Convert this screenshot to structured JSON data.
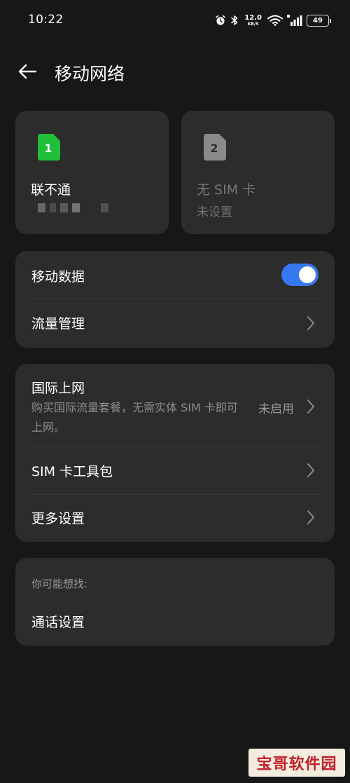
{
  "status_bar": {
    "time": "10:22",
    "net_speed_value": "12.0",
    "net_speed_unit": "KB/S",
    "battery": "49"
  },
  "header": {
    "title": "移动网络"
  },
  "sim_cards": [
    {
      "badge": "1",
      "name": "联不通",
      "status": "",
      "color": "#1fbf3a"
    },
    {
      "badge": "2",
      "name": "无 SIM 卡",
      "status": "未设置",
      "color": "#8a8a8a"
    }
  ],
  "data_group": {
    "mobile_data_label": "移动数据",
    "mobile_data_enabled": true,
    "traffic_label": "流量管理"
  },
  "more_group": {
    "intl_title": "国际上网",
    "intl_desc": "购买国际流量套餐，无需实体 SIM 卡即可上网。",
    "intl_status": "未启用",
    "sim_toolkit_label": "SIM 卡工具包",
    "more_settings_label": "更多设置"
  },
  "suggest_group": {
    "caption": "你可能想找:",
    "call_settings_label": "通话设置"
  },
  "watermark": "宝哥软件园",
  "colors": {
    "background": "#171717",
    "card": "#2c2c2c",
    "accent": "#3877f2",
    "sim1": "#1fbf3a"
  }
}
